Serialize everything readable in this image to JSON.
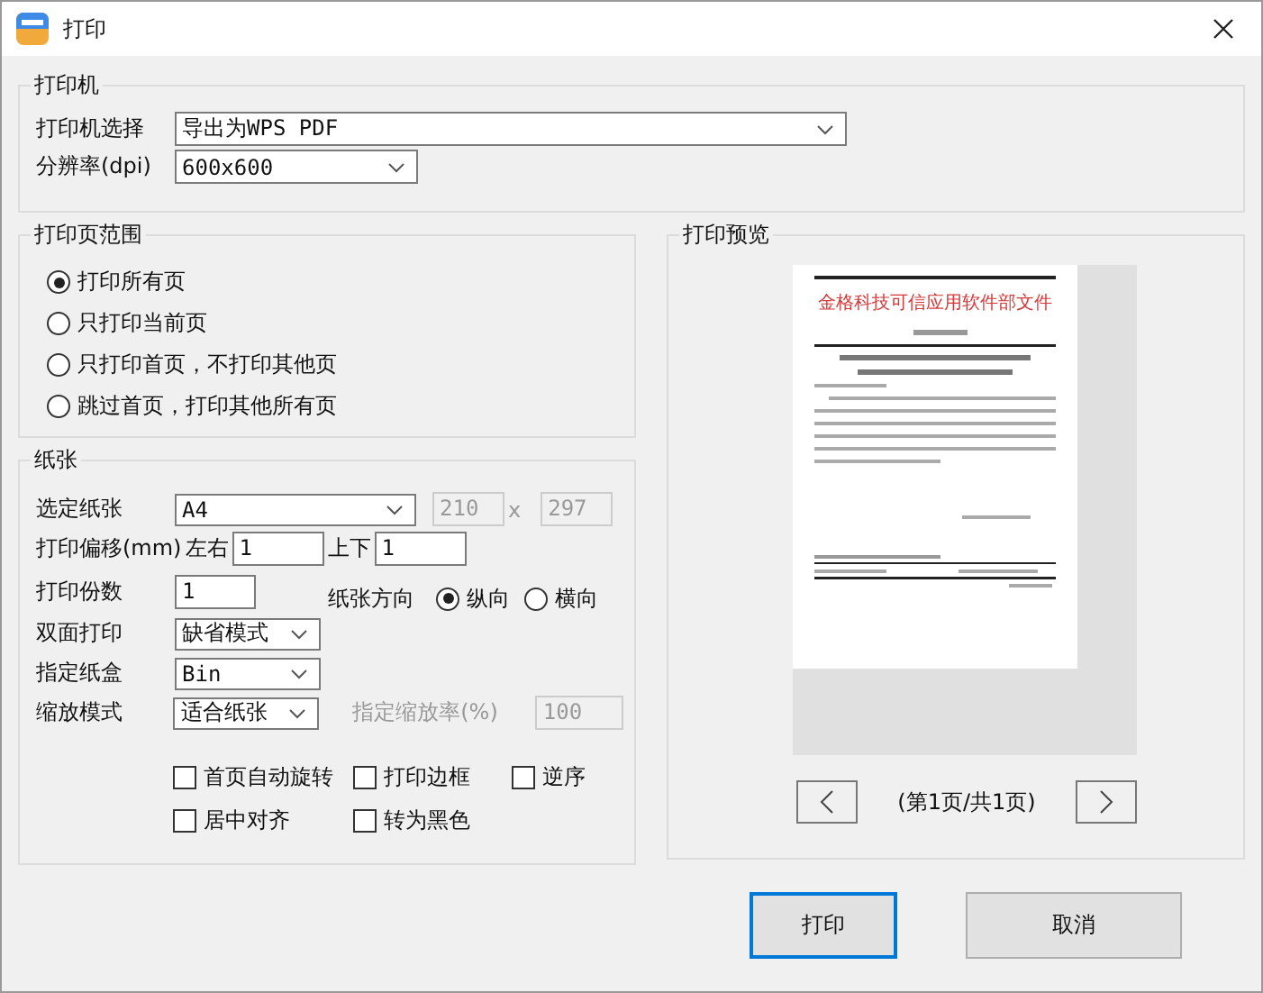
{
  "window": {
    "title": "打印"
  },
  "printer": {
    "title": "打印机",
    "fields": [
      {
        "label": "打印机选择",
        "value": "导出为WPS PDF"
      },
      {
        "label": "分辨率(dpi)",
        "value": "600x600"
      }
    ]
  },
  "range": {
    "title": "打印页范围",
    "options": [
      {
        "label": "打印所有页",
        "selected": true
      },
      {
        "label": "只打印当前页",
        "selected": false
      },
      {
        "label": "只打印首页，不打印其他页",
        "selected": false
      },
      {
        "label": "跳过首页，打印其他所有页",
        "selected": false
      }
    ]
  },
  "paper": {
    "title": "纸张",
    "paper_label": "选定纸张",
    "paper_value": "A4",
    "width_value": "210",
    "times": "x",
    "height_value": "297",
    "size_disabled": true,
    "offset_label": "打印偏移(mm)",
    "lr_label": "左右",
    "lr_value": "1",
    "ud_label": "上下",
    "ud_value": "1",
    "copies_label": "打印份数",
    "copies_value": "1",
    "orientation_label": "纸张方向",
    "orientations": [
      {
        "label": "纵向",
        "selected": true
      },
      {
        "label": "横向",
        "selected": false
      }
    ],
    "duplex_label": "双面打印",
    "duplex_value": "缺省模式",
    "tray_label": "指定纸盒",
    "tray_value": "Bin",
    "scale_label": "缩放模式",
    "scale_value": "适合纸张",
    "ratio_label": "指定缩放率(%)",
    "ratio_value": "100",
    "ratio_disabled": true,
    "checkboxes": [
      {
        "label": "首页自动旋转",
        "checked": false
      },
      {
        "label": "打印边框",
        "checked": false
      },
      {
        "label": "逆序",
        "checked": false
      },
      {
        "label": "居中对齐",
        "checked": false
      },
      {
        "label": "转为黑色",
        "checked": false
      }
    ]
  },
  "preview": {
    "title": "打印预览",
    "page_heading": "金格科技可信应用软件部文件",
    "page_info": "(第1页/共1页)"
  },
  "buttons": [
    {
      "label": "打印",
      "default": true
    },
    {
      "label": "取消",
      "default": false
    }
  ]
}
